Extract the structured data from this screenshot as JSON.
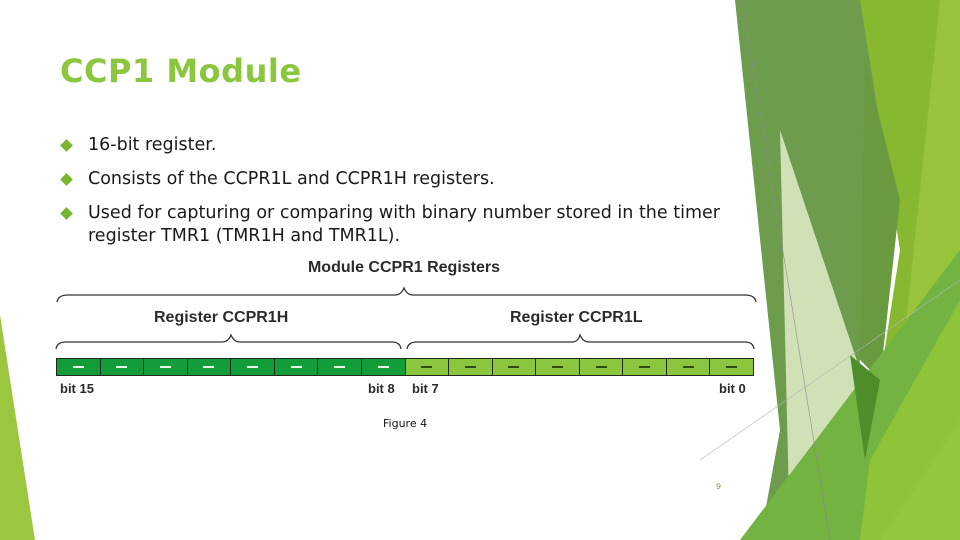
{
  "slide": {
    "title": "CCP1 Module",
    "bullets": [
      {
        "text": "16-bit register."
      },
      {
        "text": "Consists of the CCPR1L and CCPR1H registers."
      },
      {
        "text": "Used for capturing or comparing with binary number stored in the timer register TMR1 (TMR1H and TMR1L)."
      }
    ],
    "page_number": "9"
  },
  "figure": {
    "title": "Module CCPR1 Registers",
    "registers": [
      {
        "name": "Register CCPR1H",
        "bits": [
          "—",
          "—",
          "—",
          "—",
          "—",
          "—",
          "—",
          "—"
        ],
        "color": "#129c3a",
        "start_label": "bit 15",
        "end_label": "bit 8"
      },
      {
        "name": "Register CCPR1L",
        "bits": [
          "—",
          "—",
          "—",
          "—",
          "—",
          "—",
          "—",
          "—"
        ],
        "color": "#8cc63f",
        "start_label": "bit 7",
        "end_label": "bit 0"
      }
    ],
    "caption": "Figure 4"
  },
  "theme": {
    "accent": "#8cc63f",
    "dark_green": "#6a9a48",
    "bullet_color": "#7ab530"
  }
}
